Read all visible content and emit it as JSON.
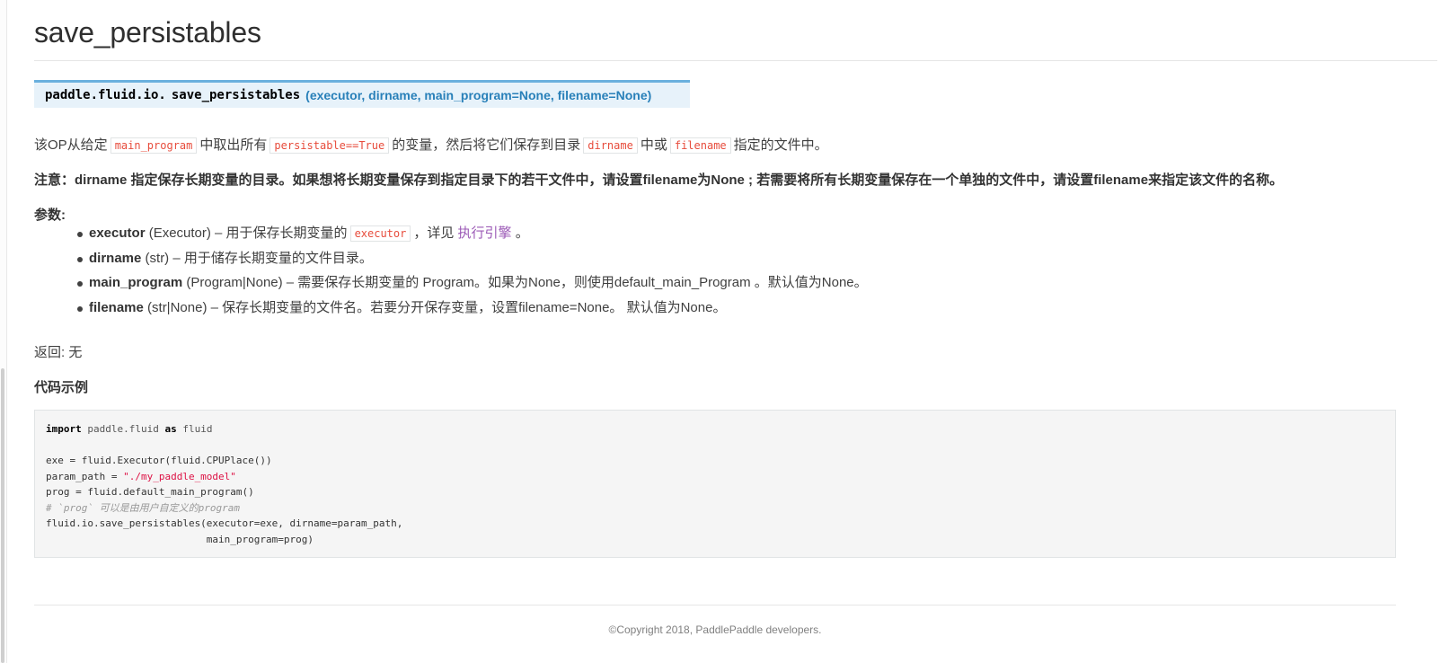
{
  "title": "save_persistables",
  "signature": {
    "module": "paddle.fluid.io.",
    "name": "save_persistables",
    "params": "(executor, dirname, main_program=None, filename=None)"
  },
  "description": {
    "t1": "该OP从给定",
    "c1": "main_program",
    "t2": "中取出所有",
    "c2": "persistable==True",
    "t3": "的变量，然后将它们保存到目录",
    "c3": "dirname",
    "t4": "中或",
    "c4": "filename",
    "t5": "指定的文件中。"
  },
  "note": "注意：dirname 指定保存长期变量的目录。如果想将长期变量保存到指定目录下的若干文件中，请设置filename为None ; 若需要将所有长期变量保存在一个单独的文件中，请设置filename来指定该文件的名称。",
  "params_heading": "参数:",
  "params": [
    {
      "name": "executor",
      "rest": " (Executor) – 用于保存长期变量的",
      "code": "executor",
      "after": "，详见",
      "link": "执行引擎",
      "end": "。"
    },
    {
      "name": "dirname",
      "rest": " (str) – 用于储存长期变量的文件目录。"
    },
    {
      "name": "main_program",
      "rest": " (Program|None) – 需要保存长期变量的 Program。如果为None，则使用default_main_Program 。默认值为None。"
    },
    {
      "name": "filename",
      "rest": " (str|None) – 保存长期变量的文件名。若要分开保存变量，设置filename=None。 默认值为None。"
    }
  ],
  "returns": "返回: 无",
  "example_heading": "代码示例",
  "code": {
    "l1_kw": "import",
    "l1_mod": "paddle.fluid",
    "l1_as": "as",
    "l1_alias": "fluid",
    "l3": "exe = fluid.Executor(fluid.CPUPlace())",
    "l4_pre": "param_path = ",
    "l4_str": "\"./my_paddle_model\"",
    "l5": "prog = fluid.default_main_program()",
    "l6": "# `prog` 可以是由用户自定义的program",
    "l7": "fluid.io.save_persistables(executor=exe, dirname=param_path,",
    "l8": "                           main_program=prog)"
  },
  "copyright": "©Copyright 2018, PaddlePaddle developers."
}
